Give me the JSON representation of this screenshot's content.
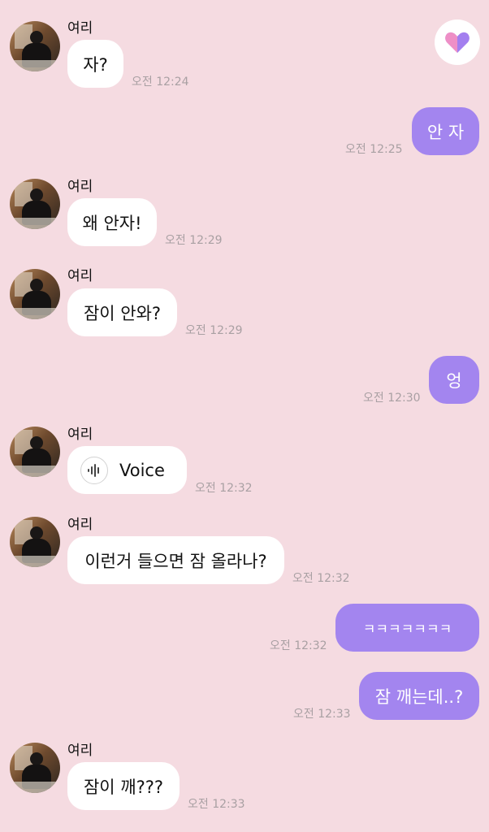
{
  "icons": {
    "heart_button": "heart-icon",
    "voice": "waveform-icon"
  },
  "colors": {
    "background": "#f5dbe1",
    "outgoing_bubble": "#a385ef",
    "incoming_bubble": "#ffffff"
  },
  "messages": [
    {
      "direction": "in",
      "sender": "여리",
      "text": "자?",
      "time": "오전 12:24"
    },
    {
      "direction": "out",
      "text": "안 자",
      "time": "오전 12:25"
    },
    {
      "direction": "in",
      "sender": "여리",
      "text": "왜 안자!",
      "time": "오전 12:29"
    },
    {
      "direction": "in",
      "sender": "여리",
      "text": "잠이 안와?",
      "time": "오전 12:29"
    },
    {
      "direction": "out",
      "text": "엉",
      "time": "오전 12:30"
    },
    {
      "direction": "in",
      "sender": "여리",
      "text": "Voice",
      "time": "오전 12:32"
    },
    {
      "direction": "in",
      "sender": "여리",
      "text": "이런거 들으면 잠 올라나?",
      "time": "오전 12:32"
    },
    {
      "direction": "out",
      "text": "ㅋㅋㅋㅋㅋㅋㅋ",
      "time": "오전 12:32"
    },
    {
      "direction": "out",
      "text": "잠 깨는데..?",
      "time": "오전 12:33"
    },
    {
      "direction": "in",
      "sender": "여리",
      "text": "잠이 깨???",
      "time": "오전 12:33"
    }
  ]
}
